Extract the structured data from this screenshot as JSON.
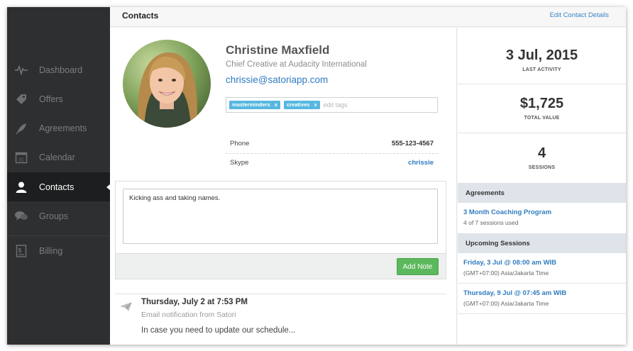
{
  "header": {
    "title": "Contacts",
    "edit_link": "Edit Contact Details"
  },
  "sidebar": {
    "items": [
      {
        "label": "Dashboard",
        "icon": "pulse-icon"
      },
      {
        "label": "Offers",
        "icon": "tag-icon"
      },
      {
        "label": "Agreements",
        "icon": "quill-icon"
      },
      {
        "label": "Calendar",
        "icon": "calendar-icon",
        "icon_text": "31"
      },
      {
        "label": "Contacts",
        "icon": "person-icon",
        "active": true
      },
      {
        "label": "Groups",
        "icon": "chat-bubbles-icon"
      },
      {
        "label": "Billing",
        "icon": "invoice-icon"
      }
    ]
  },
  "contact": {
    "name": "Christine Maxfield",
    "job_title": "Chief Creative at Audacity International",
    "email": "chrissie@satoriapp.com",
    "tags": [
      "masterminders",
      "creatives"
    ],
    "tag_remove": "x",
    "tag_placeholder": "edit tags",
    "phone_label": "Phone",
    "phone": "555-123-4567",
    "skype_label": "Skype",
    "skype": "chrissie"
  },
  "note": {
    "text": "Kicking ass and taking names.",
    "button": "Add Note"
  },
  "activity": {
    "title": "Thursday, July 2 at 7:53 PM",
    "subtitle": "Email notification from Satori",
    "body": "In case you need to update our schedule..."
  },
  "stats": [
    {
      "value": "3 Jul, 2015",
      "label": "LAST ACTIVITY"
    },
    {
      "value": "$1,725",
      "label": "TOTAL VALUE"
    },
    {
      "value": "4",
      "label": "SESSIONS"
    }
  ],
  "agreements": {
    "heading": "Agreements",
    "items": [
      {
        "title": "3 Month Coaching Program",
        "detail": "4 of 7 sessions used"
      }
    ]
  },
  "upcoming": {
    "heading": "Upcoming Sessions",
    "items": [
      {
        "title": "Friday, 3 Jul @ 08:00 am WIB",
        "detail": "(GMT+07:00) Asia/Jakarta Time"
      },
      {
        "title": "Thursday, 9 Jul @ 07:45 am WIB",
        "detail": "(GMT+07:00) Asia/Jakarta Time"
      }
    ]
  },
  "colors": {
    "sidebar": "#2e2f30",
    "link": "#2f7cc0",
    "tag": "#57b7e0",
    "add_note": "#5cb85c",
    "section_header": "#dfe4ea"
  }
}
